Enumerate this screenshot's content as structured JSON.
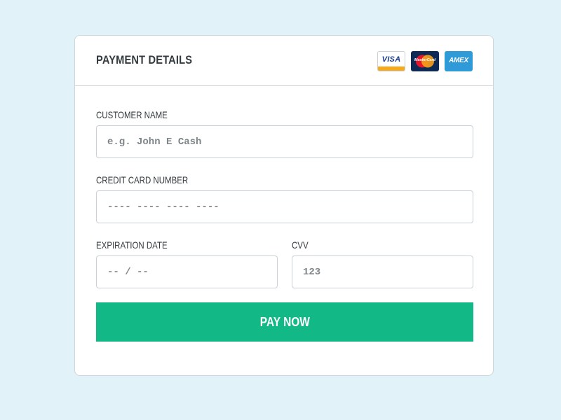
{
  "payment_form": {
    "title": "PAYMENT DETAILS",
    "card_logos": [
      {
        "name": "visa",
        "label": "VISA",
        "colors": {
          "text": "#1a3c8e",
          "stripe": "#f7a81b"
        }
      },
      {
        "name": "mastercard",
        "label": "MasterCard",
        "colors": {
          "bg": "#0e2a54",
          "left": "#e4142b",
          "right": "#f79e1b"
        }
      },
      {
        "name": "amex",
        "label": "AMEX",
        "colors": {
          "bg": "#2e9ad8"
        }
      }
    ],
    "fields": {
      "customer_name": {
        "label": "CUSTOMER NAME",
        "placeholder": "e.g. John E Cash",
        "value": ""
      },
      "card_number": {
        "label": "CREDIT CARD NUMBER",
        "placeholder": "---- ---- ---- ----",
        "value": ""
      },
      "expiration": {
        "label": "EXPIRATION DATE",
        "placeholder": "-- / --",
        "value": ""
      },
      "cvv": {
        "label": "CVV",
        "placeholder": "123",
        "value": ""
      }
    },
    "submit_label": "PAY NOW"
  },
  "colors": {
    "background": "#e2f2f9",
    "card": "#ffffff",
    "accent": "#12b886",
    "text": "#333a3e",
    "placeholder": "#7e8588",
    "border": "#c9d1d6"
  }
}
